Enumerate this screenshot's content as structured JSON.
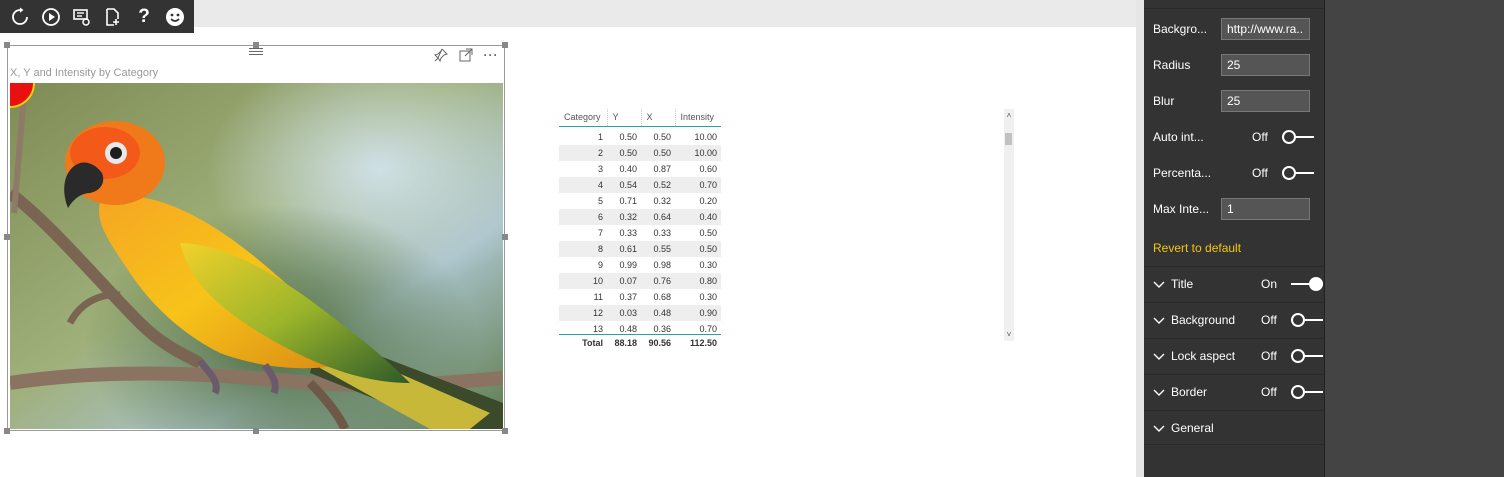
{
  "toolbar": {
    "icons": [
      "refresh-icon",
      "play-icon",
      "toggle-data-icon",
      "export-icon",
      "help-icon",
      "smiley-icon"
    ],
    "help_glyph": "?"
  },
  "visual": {
    "title": "X, Y and Intensity by Category",
    "more_glyph": "···"
  },
  "table": {
    "headers": [
      "Category",
      "Y",
      "X",
      "Intensity"
    ],
    "rows": [
      [
        "1",
        "0.50",
        "0.50",
        "10.00"
      ],
      [
        "2",
        "0.50",
        "0.50",
        "10.00"
      ],
      [
        "3",
        "0.40",
        "0.87",
        "0.60"
      ],
      [
        "4",
        "0.54",
        "0.52",
        "0.70"
      ],
      [
        "5",
        "0.71",
        "0.32",
        "0.20"
      ],
      [
        "6",
        "0.32",
        "0.64",
        "0.40"
      ],
      [
        "7",
        "0.33",
        "0.33",
        "0.50"
      ],
      [
        "8",
        "0.61",
        "0.55",
        "0.50"
      ],
      [
        "9",
        "0.99",
        "0.98",
        "0.30"
      ],
      [
        "10",
        "0.07",
        "0.76",
        "0.80"
      ],
      [
        "11",
        "0.37",
        "0.68",
        "0.30"
      ],
      [
        "12",
        "0.03",
        "0.48",
        "0.90"
      ],
      [
        "13",
        "0.48",
        "0.36",
        "0.70"
      ]
    ],
    "total": [
      "Total",
      "88.18",
      "90.56",
      "112.50"
    ]
  },
  "pane": {
    "background": {
      "label": "Backgro...",
      "value": "http://www.ra..."
    },
    "radius": {
      "label": "Radius",
      "value": "25"
    },
    "blur": {
      "label": "Blur",
      "value": "25"
    },
    "auto_intensity": {
      "label": "Auto int...",
      "state": "Off"
    },
    "percentage": {
      "label": "Percenta...",
      "state": "Off"
    },
    "max_intensity": {
      "label": "Max Inte...",
      "value": "1"
    },
    "revert": "Revert to default",
    "sections": [
      {
        "name": "Title",
        "state": "On"
      },
      {
        "name": "Background",
        "state": "Off"
      },
      {
        "name": "Lock aspect",
        "state": "Off"
      },
      {
        "name": "Border",
        "state": "Off"
      },
      {
        "name": "General",
        "state": ""
      }
    ]
  },
  "colors": {
    "pane_bg": "#333333",
    "accent_yellow": "#f2c811",
    "table_header_rule": "#2aa1a1"
  }
}
